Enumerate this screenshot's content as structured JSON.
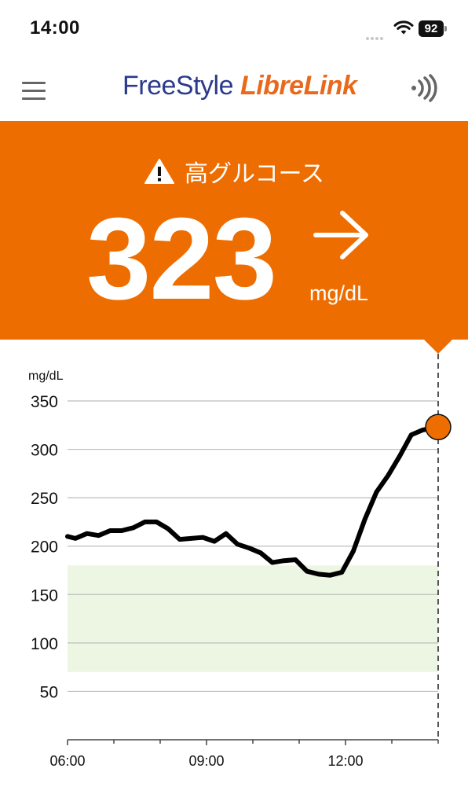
{
  "status_bar": {
    "time": "14:00",
    "battery": "92"
  },
  "header": {
    "brand_part1": "FreeStyle ",
    "brand_part2": "LibreLink",
    "menu_icon": "hamburger-menu-icon",
    "scan_icon": "nfc-scan-icon"
  },
  "reading": {
    "alert_label": "高グルコース",
    "alert_icon": "warning-triangle-icon",
    "value": "323",
    "unit": "mg/dL",
    "trend_icon": "arrow-right-icon",
    "color": "#ee6d00"
  },
  "chart_data": {
    "type": "line",
    "ylabel": "mg/dL",
    "ylim": [
      0,
      350
    ],
    "yticks": [
      350,
      300,
      250,
      200,
      150,
      100,
      50
    ],
    "x_tick_labels": [
      "06:00",
      "09:00",
      "12:00"
    ],
    "target_range": [
      70,
      180
    ],
    "target_color": "#edf6e3",
    "line_color": "#000000",
    "marker_color": "#ee6d00",
    "grid": true,
    "series": [
      {
        "x": [
          6.0,
          6.17,
          6.42,
          6.67,
          6.92,
          7.17,
          7.42,
          7.67,
          7.92,
          8.17,
          8.42,
          8.67,
          8.92,
          9.17,
          9.42,
          9.67,
          9.92,
          10.17,
          10.42,
          10.67,
          10.92,
          11.17,
          11.42,
          11.67,
          11.92,
          12.17,
          12.42,
          12.67,
          12.92,
          13.17,
          13.42,
          13.67,
          14.0
        ],
        "y": [
          210,
          208,
          213,
          211,
          216,
          216,
          219,
          225,
          225,
          218,
          207,
          208,
          209,
          205,
          213,
          202,
          198,
          193,
          183,
          185,
          186,
          174,
          171,
          170,
          173,
          195,
          228,
          256,
          273,
          293,
          315,
          320,
          323
        ]
      }
    ]
  }
}
